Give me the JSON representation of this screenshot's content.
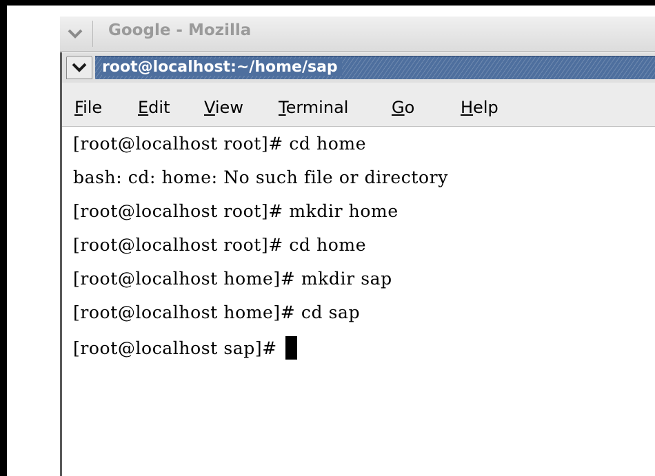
{
  "browser_window": {
    "title": "Google - Mozilla"
  },
  "terminal_window": {
    "title": "root@localhost:~/home/sap",
    "menu": [
      {
        "label": "File",
        "mnemonic": "F",
        "rest": "ile"
      },
      {
        "label": "Edit",
        "mnemonic": "E",
        "rest": "dit"
      },
      {
        "label": "View",
        "mnemonic": "V",
        "rest": "iew"
      },
      {
        "label": "Terminal",
        "mnemonic": "T",
        "rest": "erminal"
      },
      {
        "label": "Go",
        "mnemonic": "G",
        "rest": "o"
      },
      {
        "label": "Help",
        "mnemonic": "H",
        "rest": "elp"
      }
    ],
    "lines": [
      "[root@localhost root]# cd home",
      "bash: cd: home: No such file or directory",
      "[root@localhost root]# mkdir home",
      "[root@localhost root]# cd home",
      "[root@localhost home]# mkdir sap",
      "[root@localhost home]# cd sap",
      "[root@localhost sap]#"
    ]
  },
  "colors": {
    "title_active": "#4e6f9e",
    "menubar": "#ececec",
    "inactive_title_text": "#9a9a9a"
  }
}
